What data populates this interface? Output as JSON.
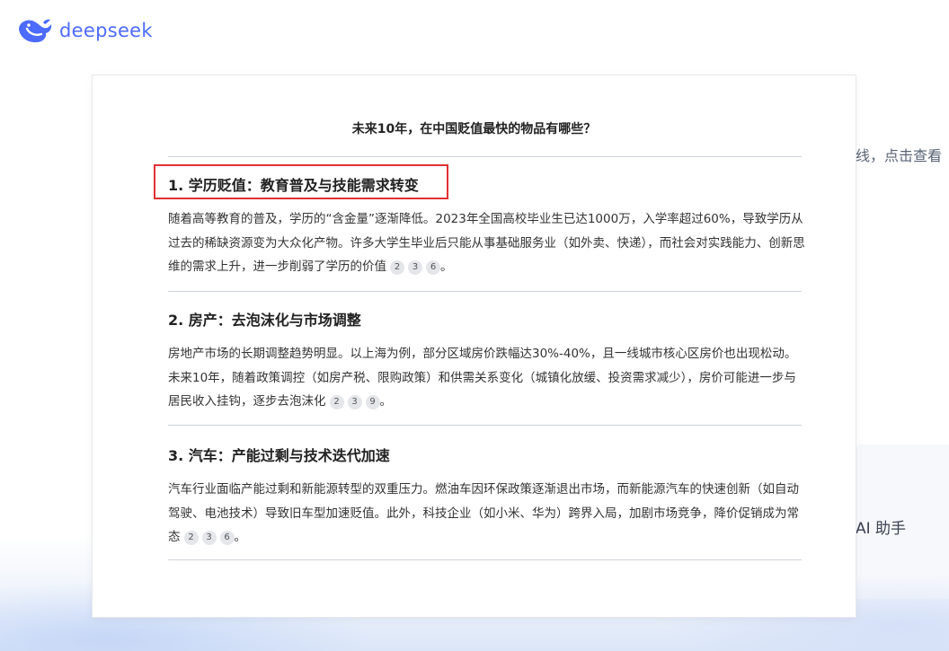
{
  "brand": {
    "name": "deepseek",
    "color": "#4d6bfe"
  },
  "background": {
    "side_text_top": "线，点击查看",
    "side_text_bottom": "AI 助手"
  },
  "card": {
    "question": "未来10年，在中国贬值最快的物品有哪些？",
    "sections": [
      {
        "title": "1. 学历贬值：教育普及与技能需求转变",
        "body": "随着高等教育的普及，学历的“含金量”逐渐降低。2023年全国高校毕业生已达1000万，入学率超过60%，导致学历从过去的稀缺资源变为大众化产物。许多大学生毕业后只能从事基础服务业（如外卖、快递），而社会对实践能力、创新思维的需求上升，进一步削弱了学历的价值",
        "citations": [
          "2",
          "3",
          "6"
        ],
        "end": "。",
        "highlighted": true
      },
      {
        "title": "2. 房产：去泡沫化与市场调整",
        "body": "房地产市场的长期调整趋势明显。以上海为例，部分区域房价跌幅达30%-40%，且一线城市核心区房价也出现松动。未来10年，随着政策调控（如房产税、限购政策）和供需关系变化（城镇化放缓、投资需求减少），房价可能进一步与居民收入挂钩，逐步去泡沫化",
        "citations": [
          "2",
          "3",
          "9"
        ],
        "end": "。",
        "highlighted": false
      },
      {
        "title": "3. 汽车：产能过剩与技术迭代加速",
        "body": "汽车行业面临产能过剩和新能源转型的双重压力。燃油车因环保政策逐渐退出市场，而新能源汽车的快速创新（如自动驾驶、电池技术）导致旧车型加速贬值。此外，科技企业（如小米、华为）跨界入局，加剧市场竞争，降价促销成为常态",
        "citations": [
          "2",
          "3",
          "6"
        ],
        "end": "。",
        "highlighted": false
      }
    ]
  }
}
